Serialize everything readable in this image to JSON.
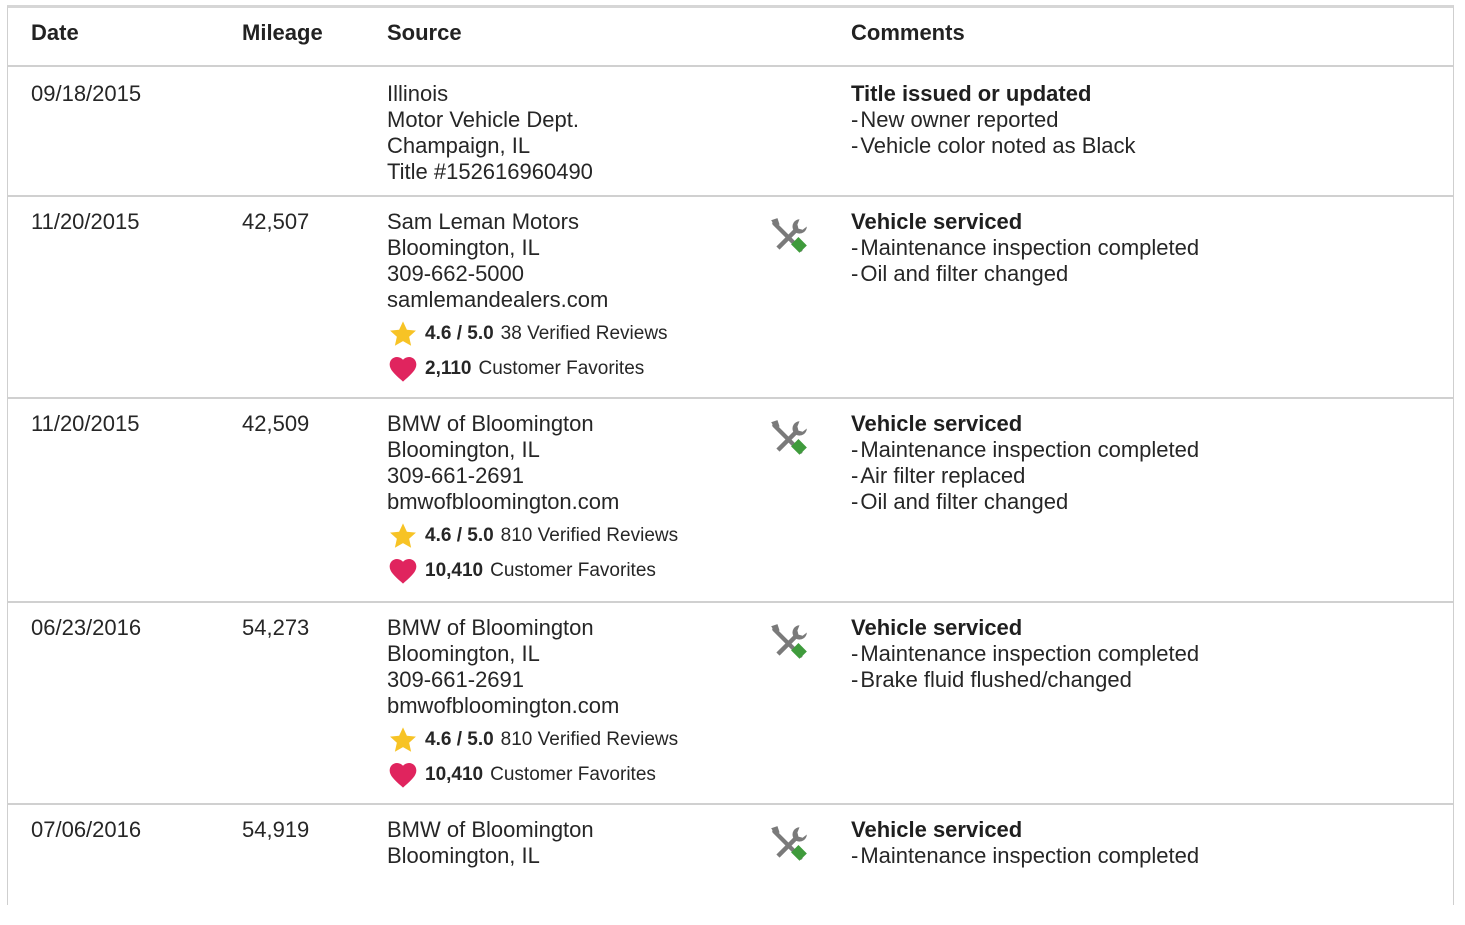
{
  "headers": {
    "date": "Date",
    "mileage": "Mileage",
    "source": "Source",
    "comments": "Comments"
  },
  "rows": [
    {
      "date": "09/18/2015",
      "mileage": "",
      "source": [
        "Illinois",
        "Motor Vehicle Dept.",
        "Champaign, IL",
        "Title #152616960490"
      ],
      "comment_title": "Title issued or updated",
      "comment_items": [
        "New owner reported",
        "Vehicle color noted as Black"
      ]
    },
    {
      "date": "11/20/2015",
      "mileage": "42,507",
      "source": [
        "Sam Leman Motors",
        "Bloomington, IL",
        "309-662-5000",
        "samlemandealers.com"
      ],
      "rating": "4.6 / 5.0",
      "reviews": "38 Verified Reviews",
      "favorites_count": "2,110",
      "favorites_label": "Customer Favorites",
      "comment_title": "Vehicle serviced",
      "comment_items": [
        "Maintenance inspection completed",
        "Oil and filter changed"
      ]
    },
    {
      "date": "11/20/2015",
      "mileage": "42,509",
      "source": [
        "BMW of Bloomington",
        "Bloomington, IL",
        "309-661-2691",
        "bmwofbloomington.com"
      ],
      "rating": "4.6 / 5.0",
      "reviews": "810 Verified Reviews",
      "favorites_count": "10,410",
      "favorites_label": "Customer Favorites",
      "comment_title": "Vehicle serviced",
      "comment_items": [
        "Maintenance inspection completed",
        "Air filter replaced",
        "Oil and filter changed"
      ]
    },
    {
      "date": "06/23/2016",
      "mileage": "54,273",
      "source": [
        "BMW of Bloomington",
        "Bloomington, IL",
        "309-661-2691",
        "bmwofbloomington.com"
      ],
      "rating": "4.6 / 5.0",
      "reviews": "810 Verified Reviews",
      "favorites_count": "10,410",
      "favorites_label": "Customer Favorites",
      "comment_title": "Vehicle serviced",
      "comment_items": [
        "Maintenance inspection completed",
        "Brake fluid flushed/changed"
      ]
    },
    {
      "date": "07/06/2016",
      "mileage": "54,919",
      "source": [
        "BMW of Bloomington",
        "Bloomington, IL"
      ],
      "comment_title": "Vehicle serviced",
      "comment_items": [
        "Maintenance inspection completed"
      ]
    }
  ],
  "icons": {
    "service": "wrench-screwdriver-icon",
    "rating": "star-icon",
    "favorites": "heart-icon"
  },
  "colors": {
    "star": "#f7c325",
    "heart": "#e0245e",
    "tool_gray": "#7a7a7a",
    "tool_green": "#3f9b3c",
    "border": "#d0d0d0"
  }
}
